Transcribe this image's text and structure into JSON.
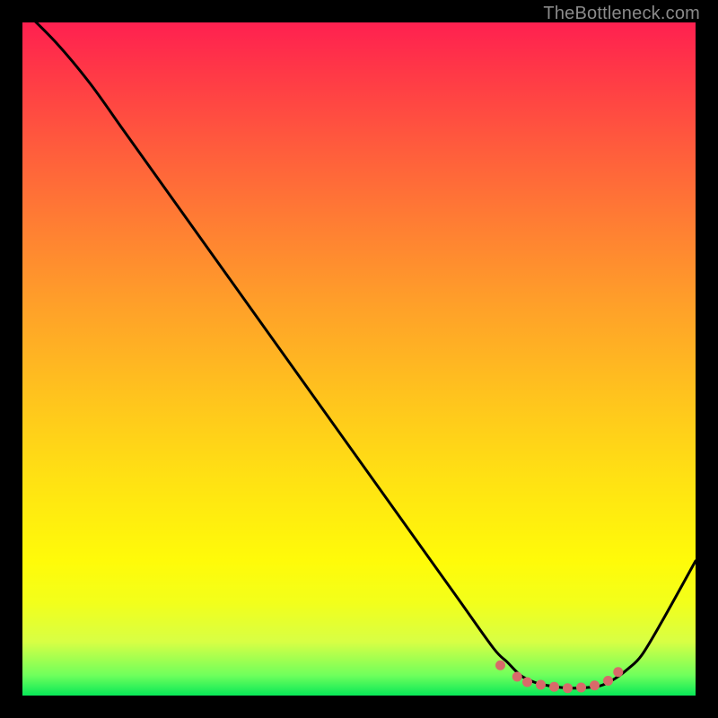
{
  "watermark": "TheBottleneck.com",
  "chart_data": {
    "type": "line",
    "title": "",
    "xlabel": "",
    "ylabel": "",
    "x_range": [
      0,
      100
    ],
    "y_range": [
      0,
      100
    ],
    "series": [
      {
        "name": "curve",
        "x": [
          0,
          5,
          10,
          15,
          20,
          25,
          30,
          35,
          40,
          45,
          50,
          55,
          60,
          65,
          70,
          72,
          74,
          76,
          78,
          80,
          82,
          84,
          86,
          88,
          90,
          92,
          95,
          100
        ],
        "y": [
          102,
          97,
          91,
          84,
          77,
          70,
          63,
          56,
          49,
          42,
          35,
          28,
          21,
          14,
          7,
          5,
          3,
          2,
          1.5,
          1.2,
          1.1,
          1.2,
          1.5,
          2.5,
          4,
          6,
          11,
          20
        ]
      },
      {
        "name": "dots",
        "x": [
          71,
          73.5,
          75,
          77,
          79,
          81,
          83,
          85,
          87,
          88.5
        ],
        "y": [
          4.5,
          2.8,
          2.0,
          1.6,
          1.3,
          1.1,
          1.2,
          1.5,
          2.2,
          3.5
        ]
      }
    ],
    "gradient_stops": [
      {
        "pct": 0,
        "color": "#ff2050"
      },
      {
        "pct": 7,
        "color": "#ff3747"
      },
      {
        "pct": 18,
        "color": "#ff5a3d"
      },
      {
        "pct": 30,
        "color": "#ff7e33"
      },
      {
        "pct": 42,
        "color": "#ffa029"
      },
      {
        "pct": 55,
        "color": "#ffc21e"
      },
      {
        "pct": 68,
        "color": "#ffe213"
      },
      {
        "pct": 80,
        "color": "#fffb09"
      },
      {
        "pct": 86,
        "color": "#f3ff1a"
      },
      {
        "pct": 92,
        "color": "#d8ff44"
      },
      {
        "pct": 97,
        "color": "#6fff5c"
      },
      {
        "pct": 100,
        "color": "#08e858"
      }
    ],
    "dot_color": "#d86a6a",
    "curve_color": "#000000"
  }
}
